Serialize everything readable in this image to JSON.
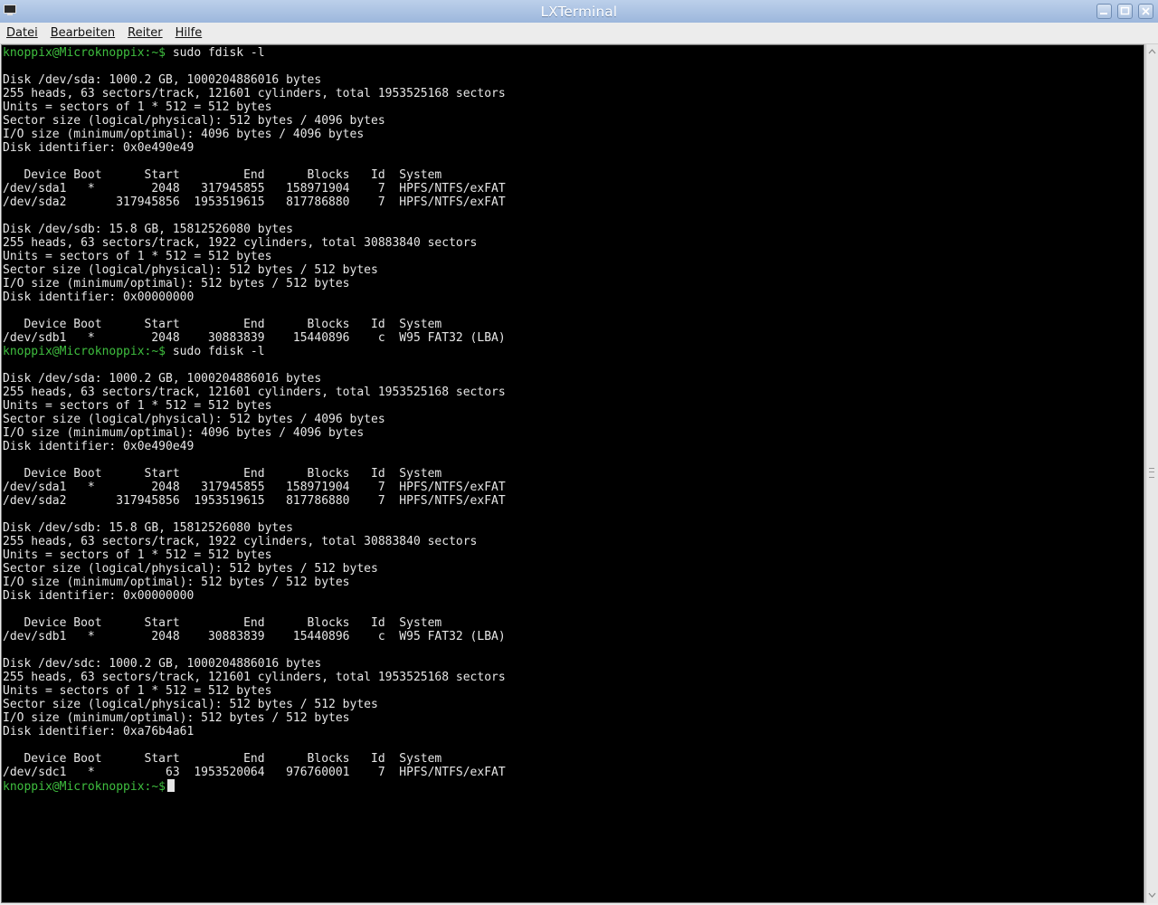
{
  "window": {
    "title": "LXTerminal"
  },
  "menu": {
    "datei": "Datei",
    "bearbeiten": "Bearbeiten",
    "reiter": "Reiter",
    "hilfe": "Hilfe"
  },
  "icons": {
    "app": "terminal-icon",
    "minimize": "minimize-icon",
    "maximize": "maximize-icon",
    "close": "close-icon"
  },
  "colors": {
    "prompt": "#3fbf3f",
    "background": "#000000",
    "text": "#e6e6e6"
  },
  "terminal": {
    "prompt": "knoppix@Microknoppix:~$",
    "lines": [
      {
        "prompt": "knoppix@Microknoppix:~$",
        "text": " sudo fdisk -l"
      },
      {
        "text": ""
      },
      {
        "text": "Disk /dev/sda: 1000.2 GB, 1000204886016 bytes"
      },
      {
        "text": "255 heads, 63 sectors/track, 121601 cylinders, total 1953525168 sectors"
      },
      {
        "text": "Units = sectors of 1 * 512 = 512 bytes"
      },
      {
        "text": "Sector size (logical/physical): 512 bytes / 4096 bytes"
      },
      {
        "text": "I/O size (minimum/optimal): 4096 bytes / 4096 bytes"
      },
      {
        "text": "Disk identifier: 0x0e490e49"
      },
      {
        "text": ""
      },
      {
        "text": "   Device Boot      Start         End      Blocks   Id  System"
      },
      {
        "text": "/dev/sda1   *        2048   317945855   158971904    7  HPFS/NTFS/exFAT"
      },
      {
        "text": "/dev/sda2       317945856  1953519615   817786880    7  HPFS/NTFS/exFAT"
      },
      {
        "text": ""
      },
      {
        "text": "Disk /dev/sdb: 15.8 GB, 15812526080 bytes"
      },
      {
        "text": "255 heads, 63 sectors/track, 1922 cylinders, total 30883840 sectors"
      },
      {
        "text": "Units = sectors of 1 * 512 = 512 bytes"
      },
      {
        "text": "Sector size (logical/physical): 512 bytes / 512 bytes"
      },
      {
        "text": "I/O size (minimum/optimal): 512 bytes / 512 bytes"
      },
      {
        "text": "Disk identifier: 0x00000000"
      },
      {
        "text": ""
      },
      {
        "text": "   Device Boot      Start         End      Blocks   Id  System"
      },
      {
        "text": "/dev/sdb1   *        2048    30883839    15440896    c  W95 FAT32 (LBA)"
      },
      {
        "prompt": "knoppix@Microknoppix:~$",
        "text": " sudo fdisk -l"
      },
      {
        "text": ""
      },
      {
        "text": "Disk /dev/sda: 1000.2 GB, 1000204886016 bytes"
      },
      {
        "text": "255 heads, 63 sectors/track, 121601 cylinders, total 1953525168 sectors"
      },
      {
        "text": "Units = sectors of 1 * 512 = 512 bytes"
      },
      {
        "text": "Sector size (logical/physical): 512 bytes / 4096 bytes"
      },
      {
        "text": "I/O size (minimum/optimal): 4096 bytes / 4096 bytes"
      },
      {
        "text": "Disk identifier: 0x0e490e49"
      },
      {
        "text": ""
      },
      {
        "text": "   Device Boot      Start         End      Blocks   Id  System"
      },
      {
        "text": "/dev/sda1   *        2048   317945855   158971904    7  HPFS/NTFS/exFAT"
      },
      {
        "text": "/dev/sda2       317945856  1953519615   817786880    7  HPFS/NTFS/exFAT"
      },
      {
        "text": ""
      },
      {
        "text": "Disk /dev/sdb: 15.8 GB, 15812526080 bytes"
      },
      {
        "text": "255 heads, 63 sectors/track, 1922 cylinders, total 30883840 sectors"
      },
      {
        "text": "Units = sectors of 1 * 512 = 512 bytes"
      },
      {
        "text": "Sector size (logical/physical): 512 bytes / 512 bytes"
      },
      {
        "text": "I/O size (minimum/optimal): 512 bytes / 512 bytes"
      },
      {
        "text": "Disk identifier: 0x00000000"
      },
      {
        "text": ""
      },
      {
        "text": "   Device Boot      Start         End      Blocks   Id  System"
      },
      {
        "text": "/dev/sdb1   *        2048    30883839    15440896    c  W95 FAT32 (LBA)"
      },
      {
        "text": ""
      },
      {
        "text": "Disk /dev/sdc: 1000.2 GB, 1000204886016 bytes"
      },
      {
        "text": "255 heads, 63 sectors/track, 121601 cylinders, total 1953525168 sectors"
      },
      {
        "text": "Units = sectors of 1 * 512 = 512 bytes"
      },
      {
        "text": "Sector size (logical/physical): 512 bytes / 512 bytes"
      },
      {
        "text": "I/O size (minimum/optimal): 512 bytes / 512 bytes"
      },
      {
        "text": "Disk identifier: 0xa76b4a61"
      },
      {
        "text": ""
      },
      {
        "text": "   Device Boot      Start         End      Blocks   Id  System"
      },
      {
        "text": "/dev/sdc1   *          63  1953520064   976760001    7  HPFS/NTFS/exFAT"
      }
    ]
  }
}
